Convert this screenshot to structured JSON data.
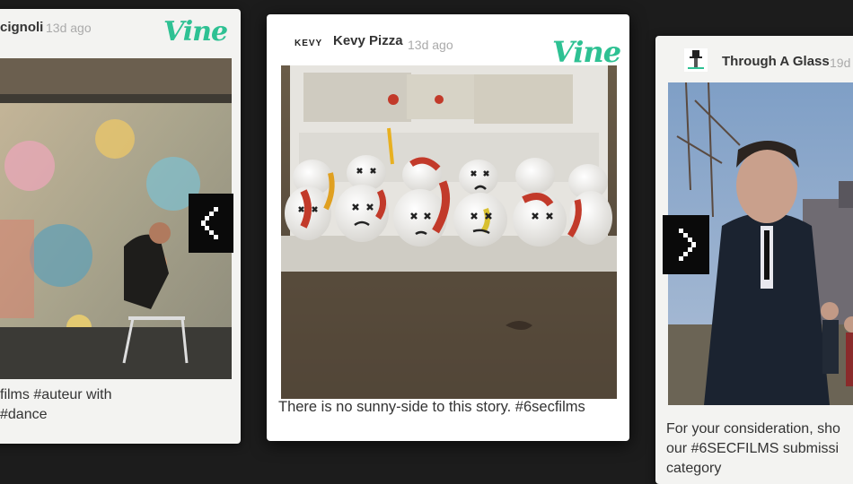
{
  "brand": {
    "logo_text": "Vine",
    "accent_color": "#2ec193"
  },
  "cards": [
    {
      "position": "left",
      "author": "cignoli",
      "timestamp": "13d ago",
      "caption_lines": [
        "films #auteur with",
        "#dance"
      ]
    },
    {
      "position": "center",
      "avatar_text": "KEVY",
      "author": "Kevy Pizza",
      "timestamp": "13d ago",
      "caption": "There is no sunny-side to this story. #6secfilms"
    },
    {
      "position": "right",
      "author": "Through A Glass",
      "timestamp": "19d",
      "caption_lines": [
        "For your consideration, sho",
        "our #6SECFILMS submissi",
        "category"
      ]
    }
  ],
  "nav": {
    "prev_icon": "chevron-left-icon",
    "next_icon": "chevron-right-icon"
  }
}
